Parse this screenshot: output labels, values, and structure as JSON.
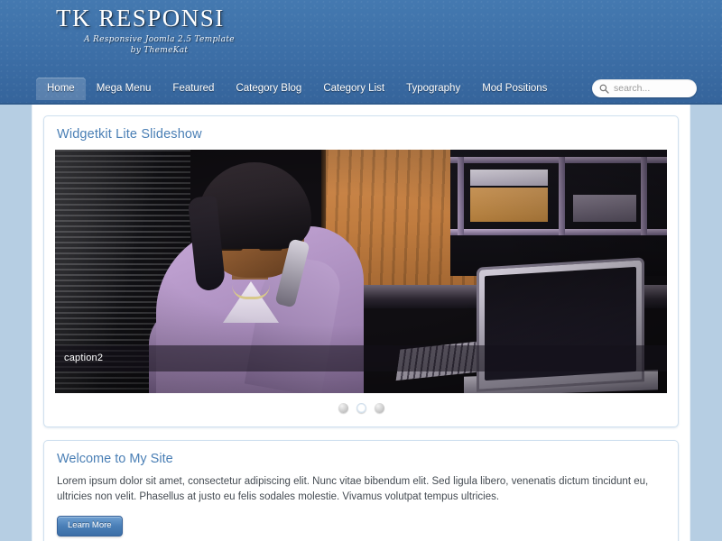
{
  "header": {
    "brand_title": "TK RESPONSI",
    "brand_tagline_line1": "A Responsive Joomla 2.5 Template",
    "brand_tagline_line2": "by ThemeKat",
    "accent_color": "#3c6ea6",
    "link_color": "#4a7fb5"
  },
  "nav": {
    "items": [
      {
        "label": "Home",
        "active": true
      },
      {
        "label": "Mega Menu",
        "active": false
      },
      {
        "label": "Featured",
        "active": false
      },
      {
        "label": "Category Blog",
        "active": false
      },
      {
        "label": "Category List",
        "active": false
      },
      {
        "label": "Typography",
        "active": false
      },
      {
        "label": "Mod Positions",
        "active": false
      }
    ]
  },
  "search": {
    "placeholder": "search...",
    "value": "",
    "icon": "search-icon"
  },
  "slideshow_module": {
    "title": "Widgetkit Lite Slideshow",
    "caption": "caption2",
    "dots": [
      {
        "label": "1",
        "active": false
      },
      {
        "label": "2",
        "active": true
      },
      {
        "label": "3",
        "active": false
      }
    ]
  },
  "welcome_module": {
    "title": "Welcome to My Site",
    "body": "Lorem ipsum dolor sit amet, consectetur adipiscing elit. Nunc vitae bibendum elit. Sed ligula libero, venenatis dictum tincidunt eu, ultricies non velit. Phasellus at justo eu felis sodales molestie. Vivamus volutpat tempus ultricies.",
    "button_label": "Learn More"
  }
}
